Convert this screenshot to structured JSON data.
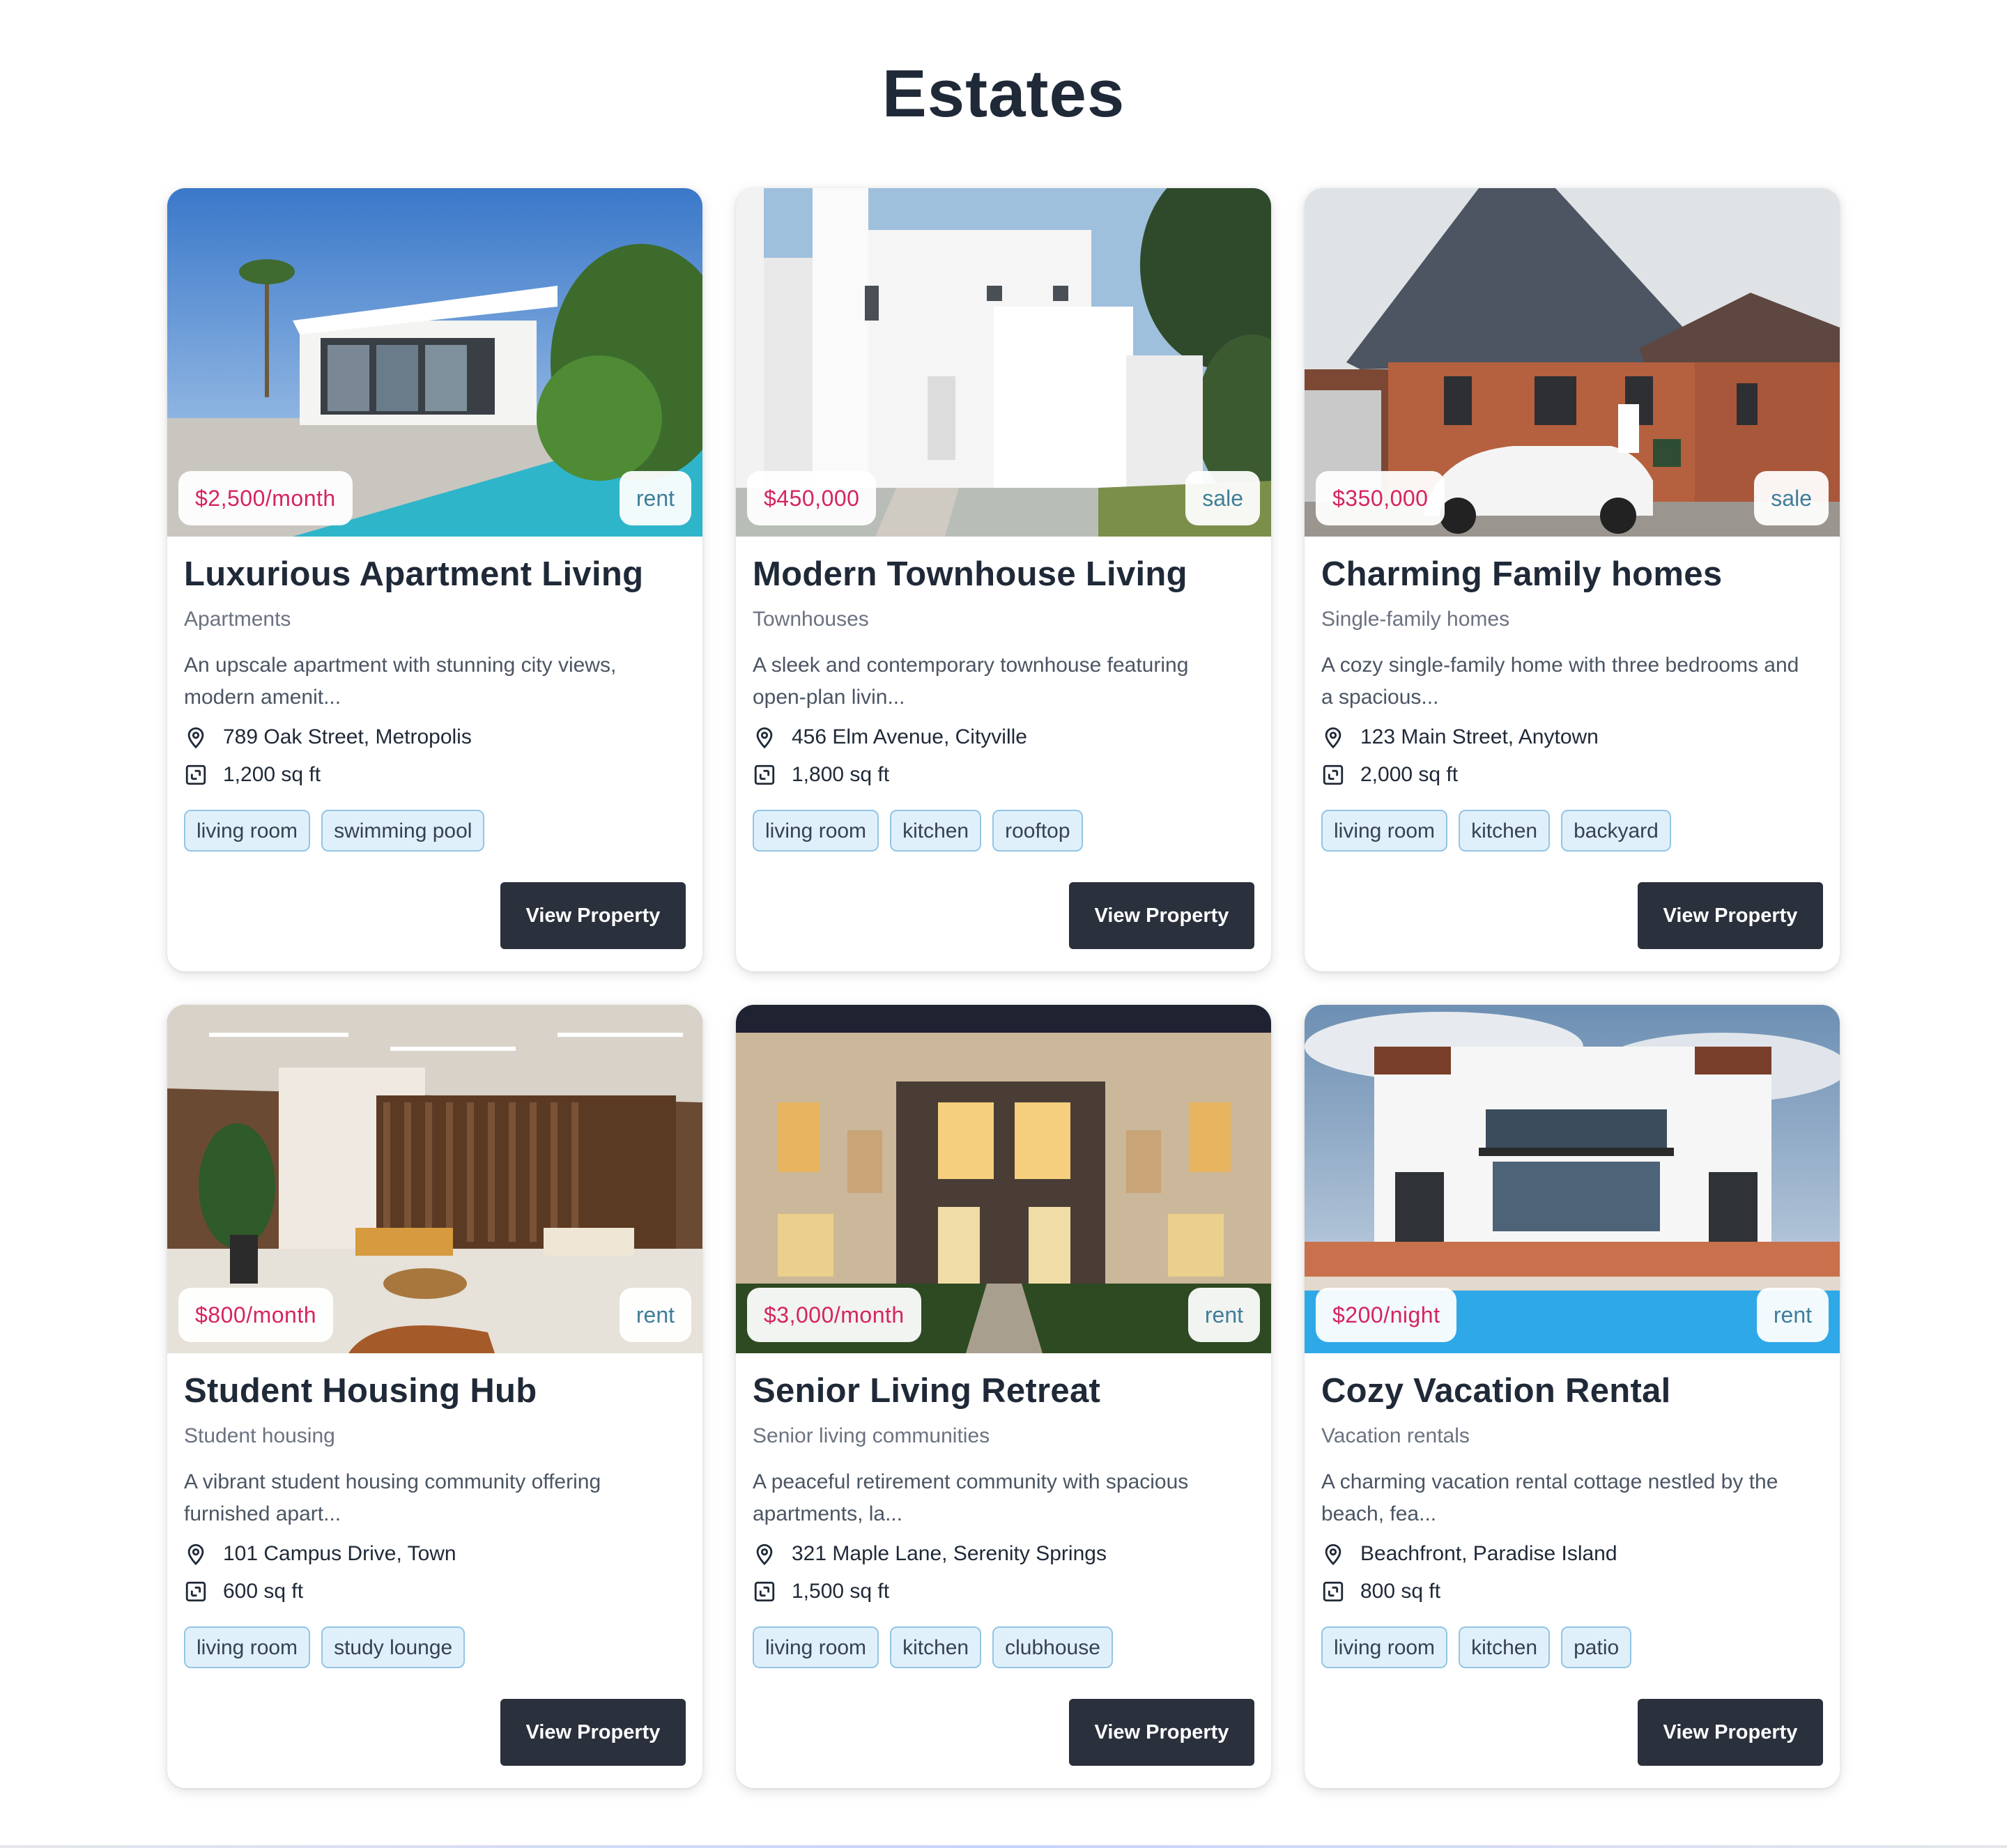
{
  "page": {
    "title": "Estates"
  },
  "colors": {
    "price": "#d6245f",
    "type": "#3f7e99",
    "button": "#2a303c",
    "tag_bg": "#e0f0fb",
    "tag_border": "#93c5e4"
  },
  "icons": {
    "location": "map-pin-icon",
    "area": "square-footage-icon"
  },
  "cards": [
    {
      "price": "$2,500/month",
      "type": "rent",
      "title": "Luxurious Apartment Living",
      "category": "Apartments",
      "description": "An upscale apartment with stunning city views, modern amenit...",
      "address": "789 Oak Street, Metropolis",
      "area": "1,200 sq ft",
      "tags": [
        "living room",
        "swimming pool"
      ],
      "button": "View Property",
      "photo": "modern-villa-pool"
    },
    {
      "price": "$450,000",
      "type": "sale",
      "title": "Modern Townhouse Living",
      "category": "Townhouses",
      "description": "A sleek and contemporary townhouse featuring open-plan livin...",
      "address": "456 Elm Avenue, Cityville",
      "area": "1,800 sq ft",
      "tags": [
        "living room",
        "kitchen",
        "rooftop"
      ],
      "button": "View Property",
      "photo": "white-townhouse"
    },
    {
      "price": "$350,000",
      "type": "sale",
      "title": "Charming Family homes",
      "category": "Single-family homes",
      "description": "A cozy single-family home with three bedrooms and a spacious...",
      "address": "123 Main Street, Anytown",
      "area": "2,000 sq ft",
      "tags": [
        "living room",
        "kitchen",
        "backyard"
      ],
      "button": "View Property",
      "photo": "brick-house-car"
    },
    {
      "price": "$800/month",
      "type": "rent",
      "title": "Student Housing Hub",
      "category": "Student housing",
      "description": "A vibrant student housing community offering furnished apart...",
      "address": "101 Campus Drive, Town",
      "area": "600 sq ft",
      "tags": [
        "living room",
        "study lounge"
      ],
      "button": "View Property",
      "photo": "lounge-interior"
    },
    {
      "price": "$3,000/month",
      "type": "rent",
      "title": "Senior Living Retreat",
      "category": "Senior living communities",
      "description": "A peaceful retirement community with spacious apartments, la...",
      "address": "321 Maple Lane, Serenity Springs",
      "area": "1,500 sq ft",
      "tags": [
        "living room",
        "kitchen",
        "clubhouse"
      ],
      "button": "View Property",
      "photo": "townhouses-night"
    },
    {
      "price": "$200/night",
      "type": "rent",
      "title": "Cozy Vacation Rental",
      "category": "Vacation rentals",
      "description": "A charming vacation rental cottage nestled by the beach, fea...",
      "address": "Beachfront, Paradise Island",
      "area": "800 sq ft",
      "tags": [
        "living room",
        "kitchen",
        "patio"
      ],
      "button": "View Property",
      "photo": "villa-pool-sky"
    }
  ]
}
